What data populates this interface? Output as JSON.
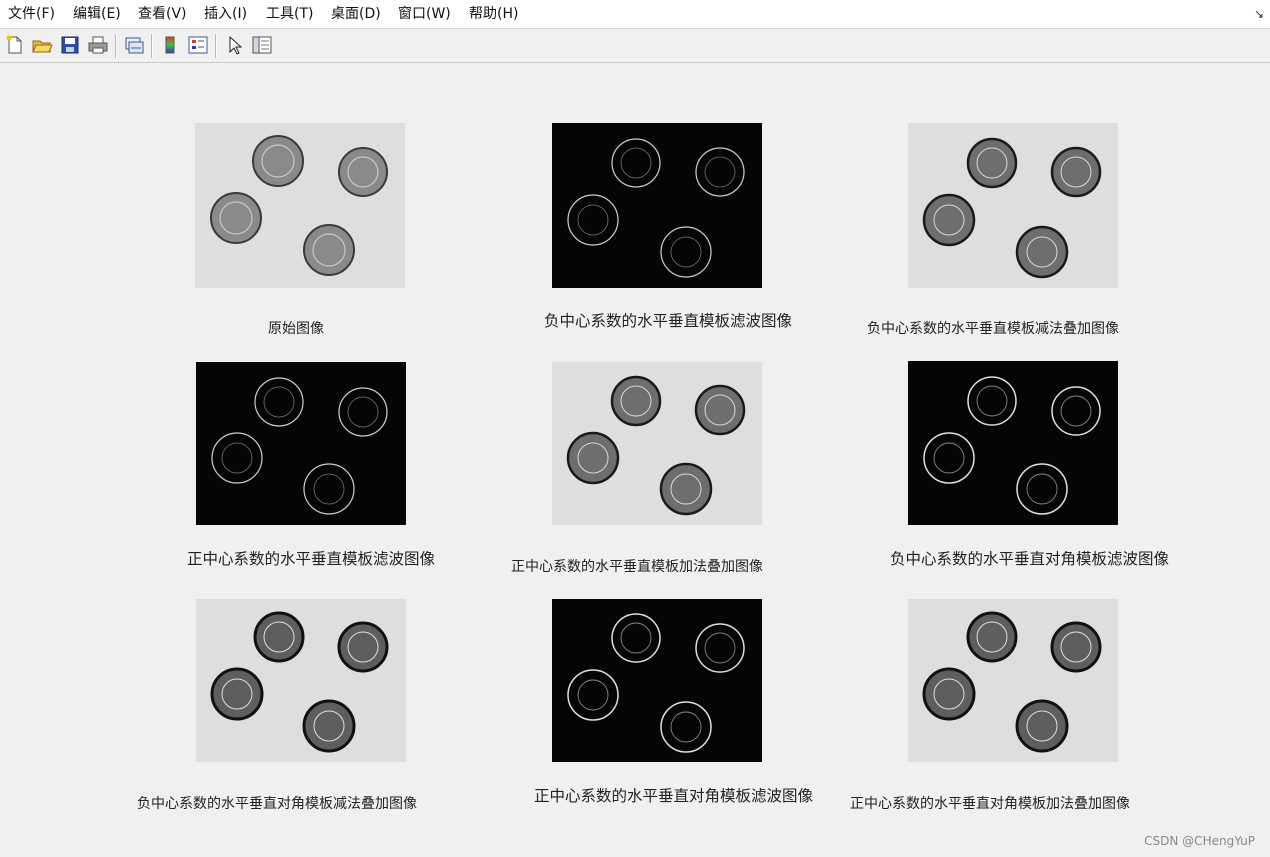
{
  "menu": {
    "file": "文件(F)",
    "edit": "编辑(E)",
    "view": "查看(V)",
    "insert": "插入(I)",
    "tools": "工具(T)",
    "desktop": "桌面(D)",
    "window": "窗口(W)",
    "help": "帮助(H)",
    "dock_glyph": "↘"
  },
  "toolbar": {
    "icons": [
      "new-figure-icon",
      "open-file-icon",
      "save-icon",
      "print-icon",
      "link-plot-icon",
      "insert-colorbar-icon",
      "insert-legend-icon",
      "edit-plot-icon",
      "property-inspector-icon"
    ]
  },
  "figures": {
    "original": "原始图像",
    "neg_hv_filter": "负中心系数的水平垂直模板滤波图像",
    "neg_hv_sub": "负中心系数的水平垂直模板减法叠加图像",
    "pos_hv_filter": "正中心系数的水平垂直模板滤波图像",
    "pos_hv_add": "正中心系数的水平垂直模板加法叠加图像",
    "neg_diag_filter": "负中心系数的水平垂直对角模板滤波图像",
    "neg_diag_sub": "负中心系数的水平垂直对角模板减法叠加图像",
    "pos_diag_filter": "正中心系数的水平垂直对角模板滤波图像",
    "pos_diag_add": "正中心系数的水平垂直对角模板加法叠加图像"
  },
  "colors": {
    "light_bg": "#dedede",
    "dark_bg": "#050505",
    "coin_light": "#8a8a8a",
    "coin_edge": "#d8d8d8"
  },
  "watermark": "CSDN @CHengYuP"
}
